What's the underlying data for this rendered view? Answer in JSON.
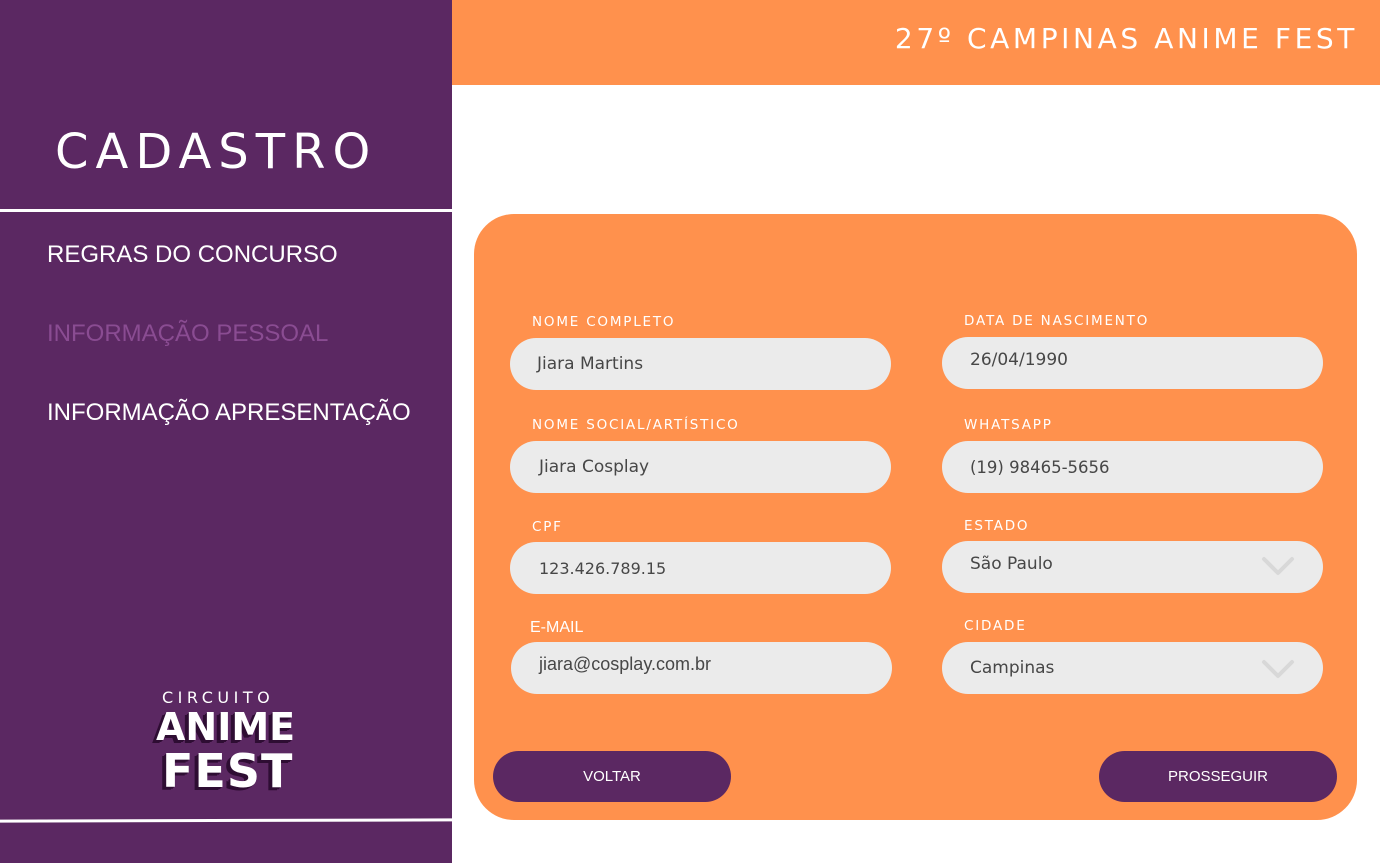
{
  "sidebar": {
    "title": "CADASTRO",
    "nav": [
      {
        "label": "REGRAS DO CONCURSO",
        "active": false
      },
      {
        "label": "INFORMAÇÃO PESSOAL",
        "active": true
      },
      {
        "label": "INFORMAÇÃO APRESENTAÇÃO",
        "active": false
      }
    ],
    "logo": {
      "line1": "CIRCUITO",
      "line2": "ANIME",
      "line3": "FEST"
    }
  },
  "header": {
    "title": "27º CAMPINAS ANIME FEST"
  },
  "form": {
    "fields": {
      "nome_completo": {
        "label": "NOME COMPLETO",
        "value": "Jiara Martins"
      },
      "nome_social": {
        "label": "NOME SOCIAL/ARTÍSTICO",
        "value": "Jiara Cosplay"
      },
      "cpf": {
        "label": "CPF",
        "value": "123.426.789.15"
      },
      "email": {
        "label": "E-MAIL",
        "value": "jiara@cosplay.com.br"
      },
      "data_nascimento": {
        "label": "DATA DE NASCIMENTO",
        "value": "26/04/1990"
      },
      "whatsapp": {
        "label": "WHATSAPP",
        "value": "(19) 98465-5656"
      },
      "estado": {
        "label": "ESTADO",
        "value": "São Paulo",
        "icon": "chevron-down-icon"
      },
      "cidade": {
        "label": "CIDADE",
        "value": "Campinas",
        "icon": "chevron-down-icon"
      }
    },
    "buttons": {
      "back": "VOLTAR",
      "next": "PROSSEGUIR"
    }
  },
  "colors": {
    "purple": "#5b2862",
    "orange": "#ff914d",
    "field_bg": "#ebebeb",
    "active_nav": "#8a4c92"
  }
}
